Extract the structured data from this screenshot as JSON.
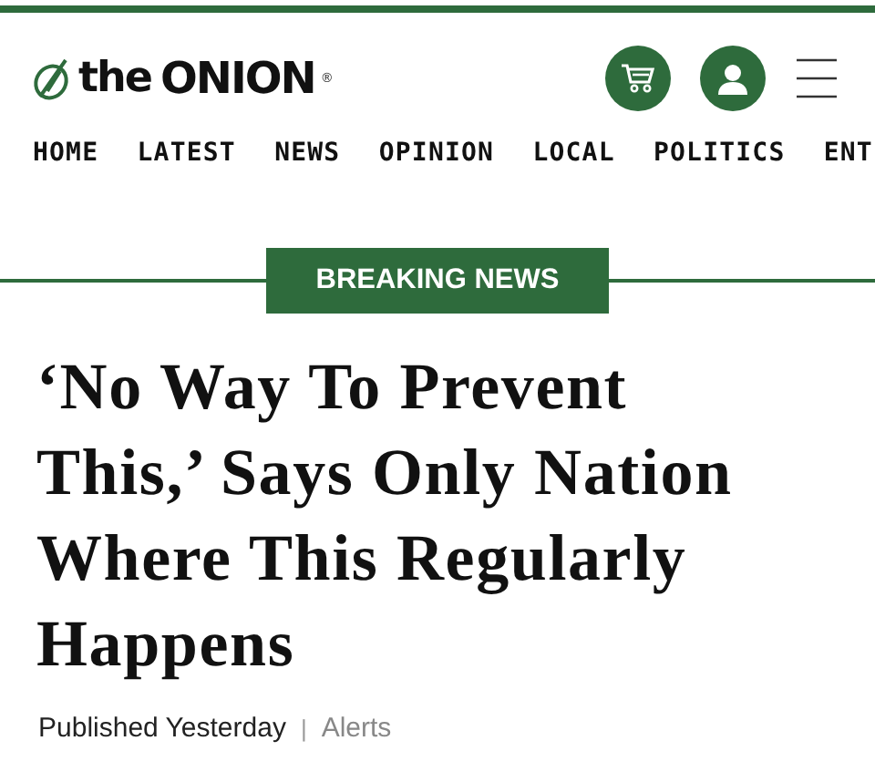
{
  "logo": {
    "word_1": "the",
    "word_2": "ONION",
    "mark": "®"
  },
  "nav": [
    {
      "label": "HOME"
    },
    {
      "label": "LATEST"
    },
    {
      "label": "NEWS"
    },
    {
      "label": "OPINION"
    },
    {
      "label": "LOCAL"
    },
    {
      "label": "POLITICS"
    },
    {
      "label": "ENT"
    }
  ],
  "article": {
    "banner": "BREAKING NEWS",
    "headline": "‘No Way To Prevent This,’ Says Only Nation Where This Regularly Happens",
    "published": "Published Yesterday",
    "separator": "|",
    "alerts": "Alerts"
  }
}
